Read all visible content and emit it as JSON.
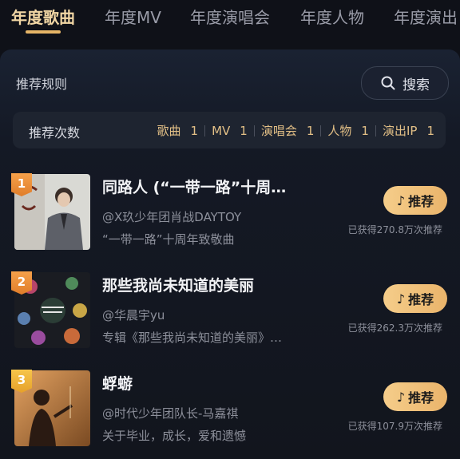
{
  "tabs": [
    {
      "label": "年度歌曲",
      "active": true
    },
    {
      "label": "年度MV",
      "active": false
    },
    {
      "label": "年度演唱会",
      "active": false
    },
    {
      "label": "年度人物",
      "active": false
    },
    {
      "label": "年度演出",
      "active": false
    }
  ],
  "panel": {
    "rules_title": "推荐规则",
    "search": {
      "icon": "search-icon",
      "label": "搜索"
    },
    "counts": {
      "label": "推荐次数",
      "items": [
        {
          "name": "歌曲",
          "count": "1"
        },
        {
          "name": "MV",
          "count": "1"
        },
        {
          "name": "演唱会",
          "count": "1"
        },
        {
          "name": "人物",
          "count": "1"
        },
        {
          "name": "演出IP",
          "count": "1"
        }
      ]
    }
  },
  "songs": [
    {
      "rank": "1",
      "title": "同路人 (“一带一路”十周…",
      "artist": "@X玖少年团肖战DAYTOY",
      "desc": "“一带一路”十周年致敬曲",
      "button": "推荐",
      "stats": "已获得270.8万次推荐"
    },
    {
      "rank": "2",
      "title": "那些我尚未知道的美丽",
      "artist": "@华晨宇yu",
      "desc": "专辑《那些我尚未知道的美丽》…",
      "button": "推荐",
      "stats": "已获得262.3万次推荐"
    },
    {
      "rank": "3",
      "title": "蜉蝣",
      "artist": "@时代少年团队长-马嘉祺",
      "desc": "关于毕业，成长，爱和遗憾",
      "button": "推荐",
      "stats": "已获得107.9万次推荐"
    }
  ],
  "colors": {
    "accent": "#e6b567",
    "button": "#f0c27a",
    "rank": "#f0902f"
  }
}
